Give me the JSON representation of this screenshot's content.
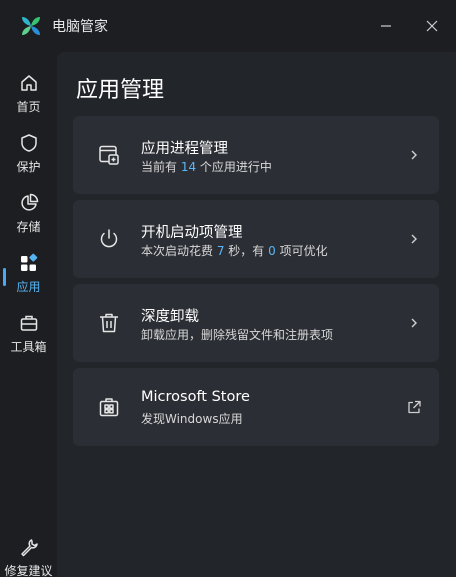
{
  "window": {
    "title": "电脑管家",
    "minimize_icon": "minimize-icon",
    "close_icon": "close-icon"
  },
  "sidebar": {
    "items": [
      {
        "label": "首页",
        "icon": "home-icon"
      },
      {
        "label": "保护",
        "icon": "shield-icon"
      },
      {
        "label": "存储",
        "icon": "pie-chart-icon"
      },
      {
        "label": "应用",
        "icon": "apps-icon",
        "active": true
      },
      {
        "label": "工具箱",
        "icon": "toolbox-icon"
      }
    ],
    "bottom": {
      "label": "修复建议",
      "icon": "wrench-icon"
    }
  },
  "main": {
    "title": "应用管理",
    "cards": [
      {
        "title": "应用进程管理",
        "sub_parts": [
          "当前有 ",
          "14",
          " 个应用进行中"
        ],
        "icon": "process-window-icon",
        "action_icon": "chevron-right-icon"
      },
      {
        "title": "开机启动项管理",
        "sub_parts": [
          "本次启动花费 ",
          "7",
          " 秒，有 ",
          "0",
          " 项可优化"
        ],
        "icon": "power-icon",
        "action_icon": "chevron-right-icon"
      },
      {
        "title": "深度卸载",
        "sub": "卸载应用，删除残留文件和注册表项",
        "icon": "trash-icon",
        "action_icon": "chevron-right-icon"
      },
      {
        "title": "Microsoft Store",
        "sub": "发现Windows应用",
        "icon": "store-icon",
        "action_icon": "external-link-icon"
      }
    ]
  },
  "colors": {
    "accent": "#4aaaf0",
    "background": "#1c1e22",
    "panel": "#22252a",
    "card": "#2b2e34"
  }
}
